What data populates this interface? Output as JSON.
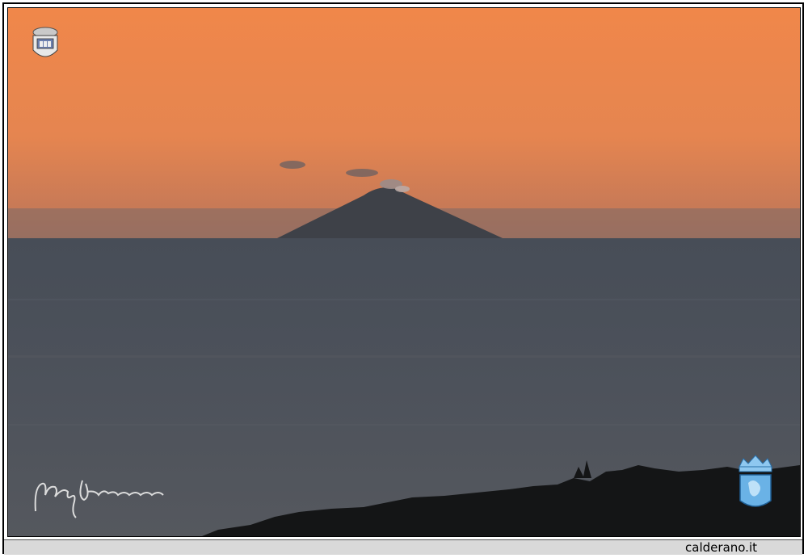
{
  "photo": {
    "subject": "",
    "sky_top": "#f08a48",
    "sky_horizon": "#c9744e",
    "sea": "#4a4f57",
    "volcano": "#3d3f45"
  },
  "watermarks": {
    "left_crest": "coat-of-arms",
    "right_crest": "crowned-shield",
    "signature": "handwritten-signature"
  },
  "footer": {
    "site": "calderano.it"
  }
}
